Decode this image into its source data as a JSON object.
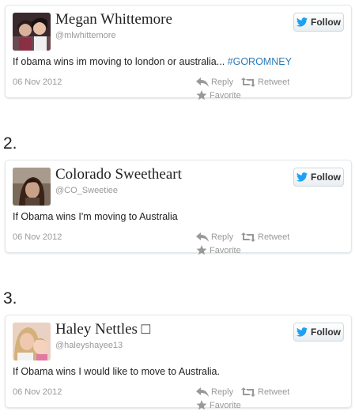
{
  "colors": {
    "twitter_blue": "#1da1f2",
    "hashtag": "#2b7bb9",
    "meta_gray": "#999999",
    "border": "#e1e8ed"
  },
  "icons": {
    "follow": "twitter-bird-icon",
    "reply": "reply-arrow-icon",
    "retweet": "retweet-icon",
    "favorite": "star-icon"
  },
  "tweets": [
    {
      "number": "",
      "name": "Megan Whittemore",
      "handle": "@mlwhittemore",
      "text": "If obama wins im moving to london or australia... ",
      "hashtag": "#GOROMNEY",
      "date": "06 Nov 2012",
      "follow_label": "Follow",
      "reply_label": "Reply",
      "retweet_label": "Retweet",
      "favorite_label": "Favorite"
    },
    {
      "number": "2.",
      "name": "Colorado Sweetheart",
      "handle": "@CO_Sweetiee",
      "text": "If Obama wins I'm moving to Australia",
      "hashtag": "",
      "date": "06 Nov 2012",
      "follow_label": "Follow",
      "reply_label": "Reply",
      "retweet_label": "Retweet",
      "favorite_label": "Favorite"
    },
    {
      "number": "3.",
      "name": "Haley Nettles □",
      "handle": "@haleyshayee13",
      "text": "If Obama wins I would like to move to Australia.",
      "hashtag": "",
      "date": "06 Nov 2012",
      "follow_label": "Follow",
      "reply_label": "Reply",
      "retweet_label": "Retweet",
      "favorite_label": "Favorite"
    }
  ]
}
